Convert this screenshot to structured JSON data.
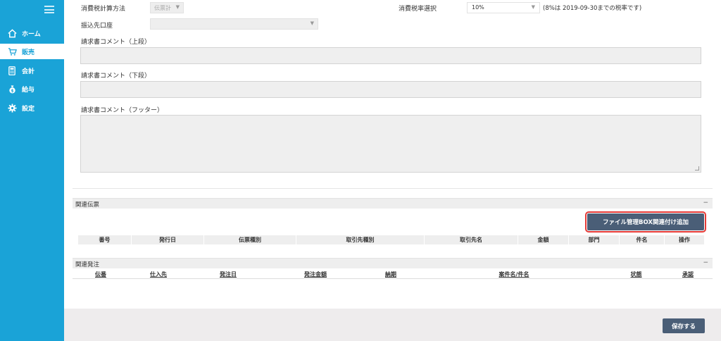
{
  "sidebar": {
    "items": [
      {
        "label": "ホーム",
        "icon": "home-icon"
      },
      {
        "label": "販売",
        "icon": "cart-icon",
        "active": true
      },
      {
        "label": "会計",
        "icon": "calculator-icon"
      },
      {
        "label": "給与",
        "icon": "money-bag-icon"
      },
      {
        "label": "設定",
        "icon": "gear-icon"
      }
    ]
  },
  "form": {
    "tax_calc_label": "消費税計算方法",
    "tax_calc_value": "伝票計",
    "tax_rate_label": "消費税率選択",
    "tax_rate_value": "10%",
    "tax_rate_note": "(8%は 2019-09-30までの税率です)",
    "bank_label": "振込先口座",
    "bank_value": "",
    "comment_upper_label": "請求書コメント（上段）",
    "comment_lower_label": "請求書コメント（下段）",
    "comment_footer_label": "請求書コメント（フッター）"
  },
  "related_slips": {
    "title": "関連伝票",
    "collapse": "−",
    "link_button": "ファイル管理BOX関連付け追加",
    "columns": [
      "番号",
      "発行日",
      "伝票種別",
      "取引先種別",
      "取引先名",
      "金額",
      "部門",
      "件名",
      "操作"
    ]
  },
  "related_orders": {
    "title": "関連発注",
    "collapse": "−",
    "columns": [
      "伝番",
      "仕入先",
      "発注日",
      "発注金額",
      "納期",
      "案件名/件名",
      "状態",
      "承認"
    ]
  },
  "footer": {
    "save_label": "保存する"
  },
  "colors": {
    "sidebar": "#1aa3d7",
    "button": "#4a5e77",
    "highlight": "#e53935"
  }
}
